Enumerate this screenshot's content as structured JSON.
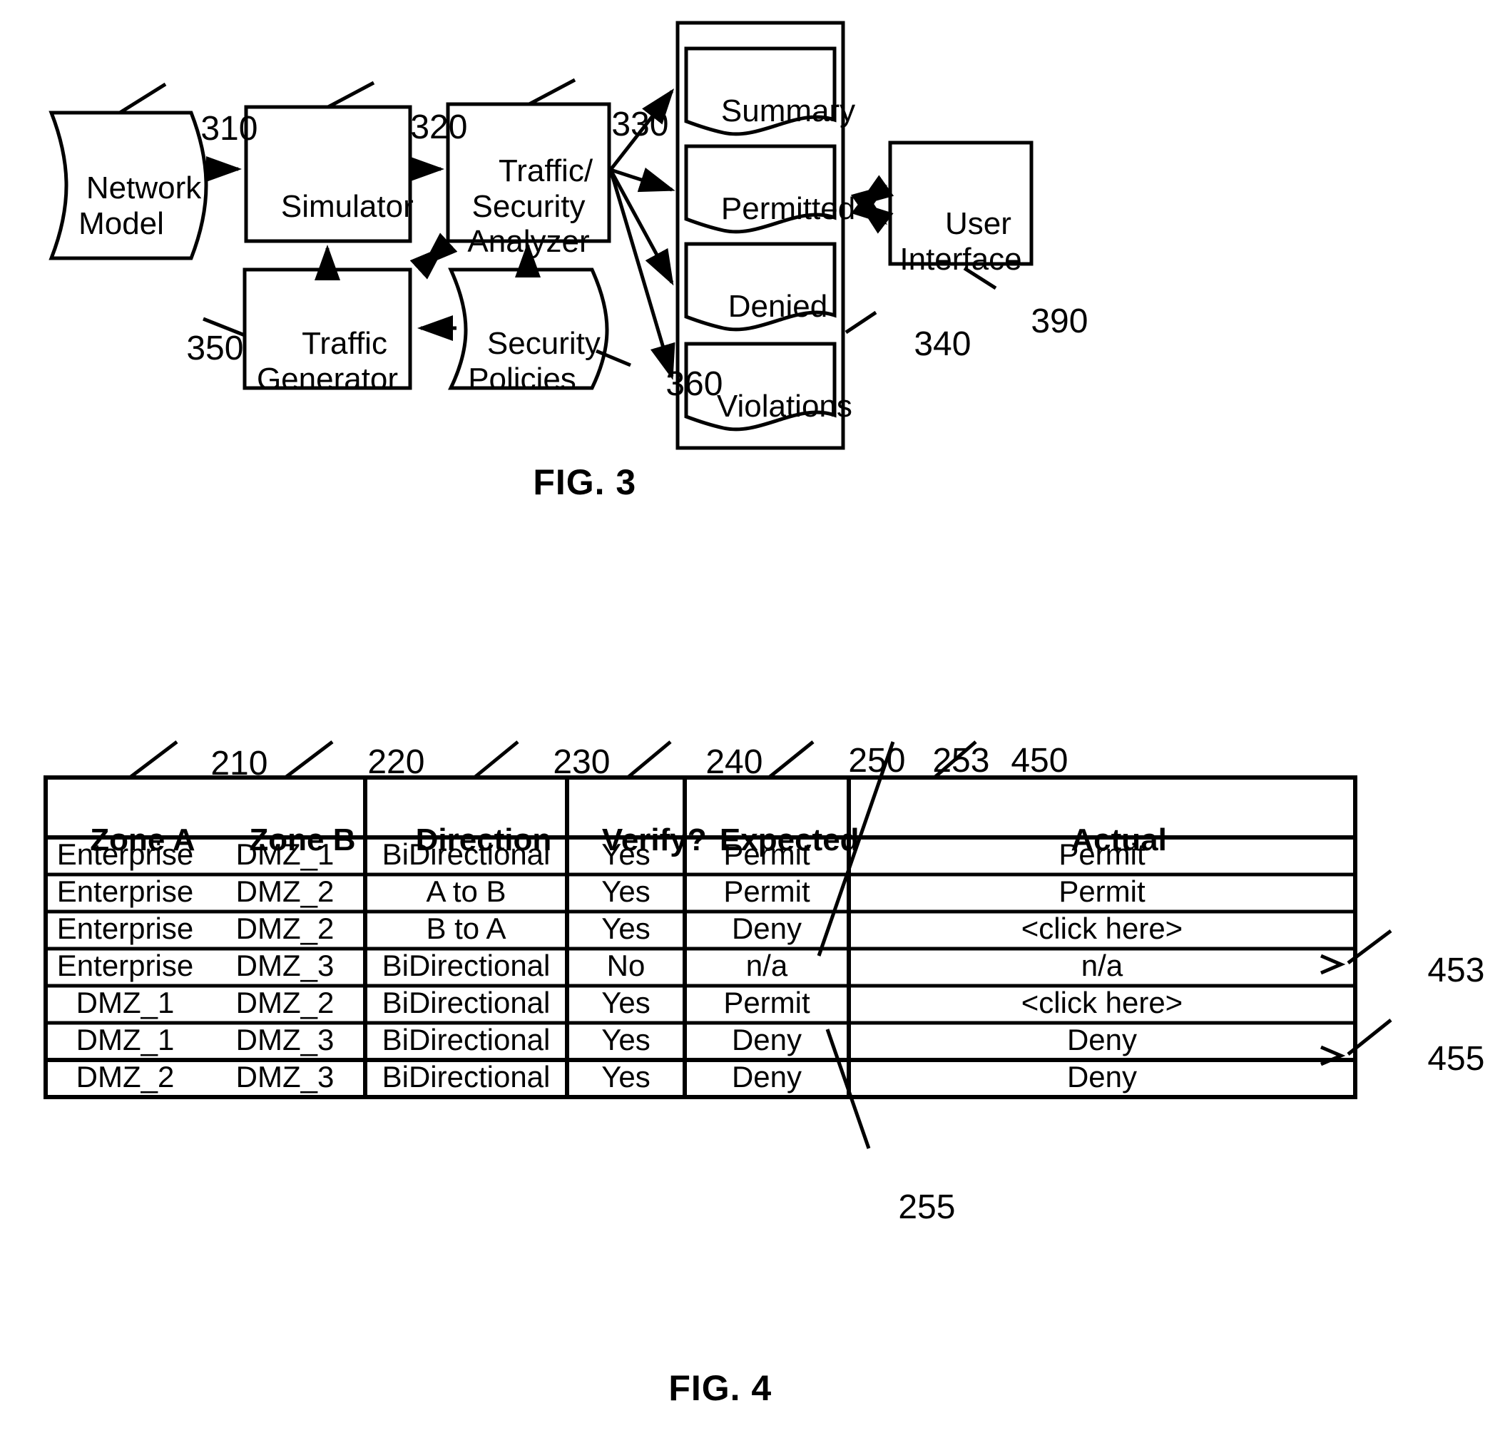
{
  "figure3": {
    "caption": "FIG. 3",
    "nodes": [
      {
        "id": "network-model",
        "label": "Network\nModel",
        "ref": "310"
      },
      {
        "id": "simulator",
        "label": "Simulator",
        "ref": "320"
      },
      {
        "id": "analyzer",
        "label": "Traffic/\nSecurity\nAnalyzer",
        "ref": "330"
      },
      {
        "id": "traffic-generator",
        "label": "Traffic\nGenerator",
        "ref": "350"
      },
      {
        "id": "security-policies",
        "label": "Security\nPolicies",
        "ref": "360"
      },
      {
        "id": "user-interface",
        "label": "User\nInterface",
        "ref": "390"
      }
    ],
    "reports_container_ref": "340",
    "reports": [
      {
        "id": "summary",
        "label": "Summary"
      },
      {
        "id": "permitted",
        "label": "Permitted"
      },
      {
        "id": "denied",
        "label": "Denied"
      },
      {
        "id": "violations",
        "label": "Violations"
      }
    ]
  },
  "figure4": {
    "caption": "FIG. 4",
    "table_ref": "450",
    "column_refs": [
      "210",
      "220",
      "230",
      "240",
      "250",
      "253"
    ],
    "row_refs": [
      "453",
      "455",
      "255"
    ],
    "columns": [
      "Zone A",
      "Zone B",
      "Direction",
      "Verify?",
      "Expected",
      "Actual"
    ],
    "rows": [
      [
        "Enterprise",
        "DMZ_1",
        "BiDirectional",
        "Yes",
        "Permit",
        "Permit"
      ],
      [
        "Enterprise",
        "DMZ_2",
        "A to B",
        "Yes",
        "Permit",
        "Permit"
      ],
      [
        "Enterprise",
        "DMZ_2",
        "B to A",
        "Yes",
        "Deny",
        "<click here>"
      ],
      [
        "Enterprise",
        "DMZ_3",
        "BiDirectional",
        "No",
        "n/a",
        "n/a"
      ],
      [
        "DMZ_1",
        "DMZ_2",
        "BiDirectional",
        "Yes",
        "Permit",
        "<click here>"
      ],
      [
        "DMZ_1",
        "DMZ_3",
        "BiDirectional",
        "Yes",
        "Deny",
        "Deny"
      ],
      [
        "DMZ_2",
        "DMZ_3",
        "BiDirectional",
        "Yes",
        "Deny",
        "Deny"
      ]
    ]
  },
  "colors": {
    "ink": "#000000",
    "paper": "#ffffff"
  }
}
